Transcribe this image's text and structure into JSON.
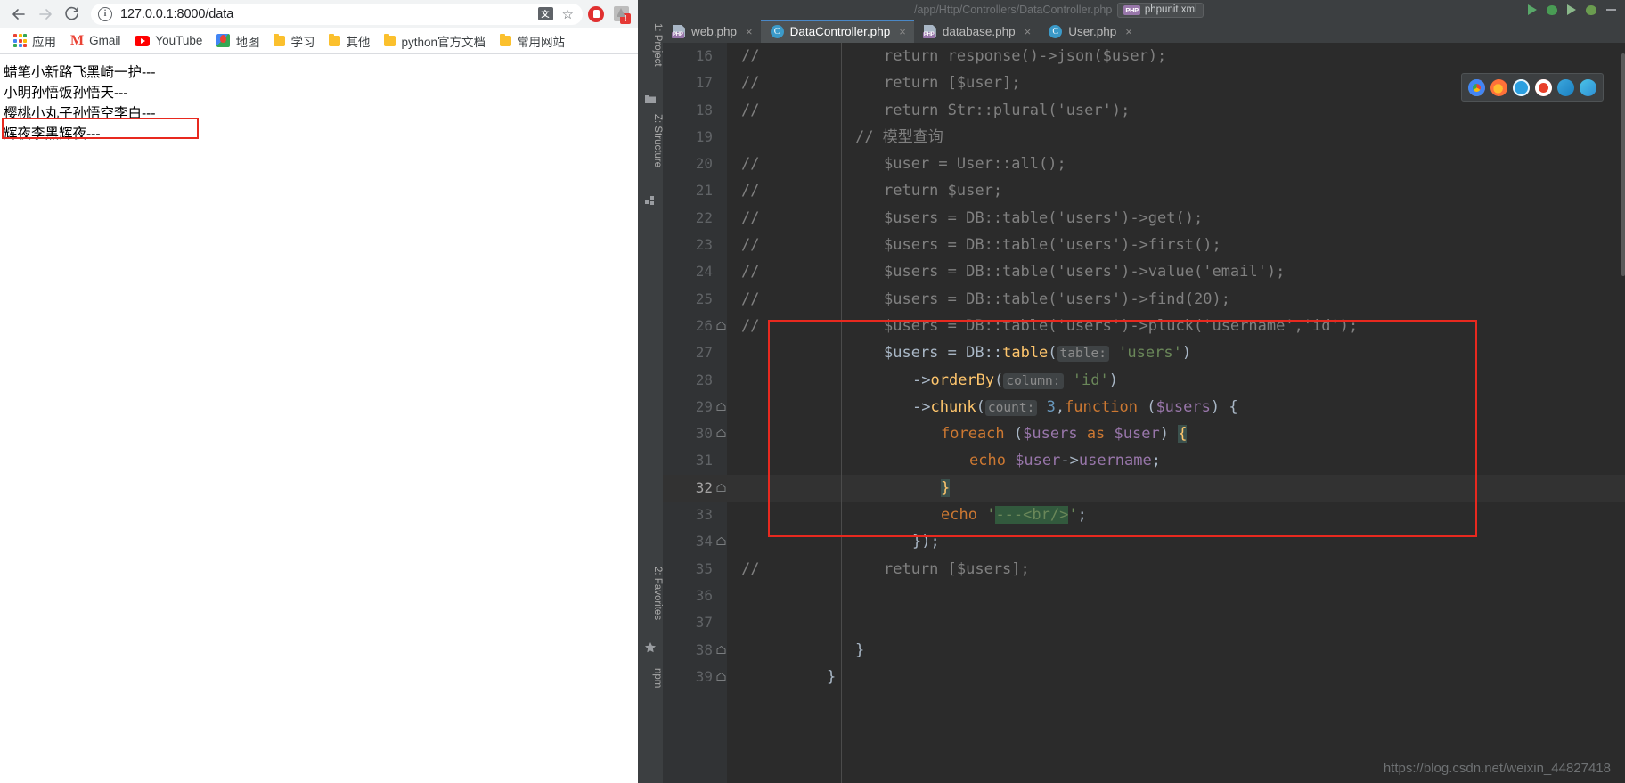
{
  "browser": {
    "nav": {
      "back": "←",
      "forward": "→",
      "reload": "⟳"
    },
    "omnibox": {
      "url": "127.0.0.1:8000/data",
      "info_icon": "info-icon",
      "translate_icon": "translate-icon",
      "star_icon": "bookmark-star-icon"
    },
    "extensions": [
      {
        "name": "adblock-extension-icon"
      },
      {
        "name": "unknown-extension-icon",
        "badge": "!"
      }
    ],
    "bookmarks": [
      {
        "label": "应用",
        "icon": "apps-grid-icon"
      },
      {
        "label": "Gmail",
        "icon": "gmail-icon"
      },
      {
        "label": "YouTube",
        "icon": "youtube-icon"
      },
      {
        "label": "地图",
        "icon": "maps-icon"
      },
      {
        "label": "学习",
        "icon": "folder-icon"
      },
      {
        "label": "其他",
        "icon": "folder-icon"
      },
      {
        "label": "python官方文档",
        "icon": "folder-icon"
      },
      {
        "label": "常用网站",
        "icon": "folder-icon"
      }
    ],
    "page_lines": [
      "蜡笔小新路飞黑崎一护---",
      "小明孙悟饭孙悟天---",
      "樱桃小丸子孙悟空李白---",
      "辉夜李黑辉夜---"
    ],
    "highlight_color": "#e8291f"
  },
  "ide": {
    "breadcrumb": "/app/Http/Controllers/DataController.php",
    "chip_label": "phpunit.xml",
    "chip_badge": "PHP",
    "tabs": [
      {
        "label": "web.php",
        "icon": "php-file-icon",
        "active": false,
        "close": "×"
      },
      {
        "label": "DataController.php",
        "icon": "php-class-icon",
        "active": true,
        "close": "×"
      },
      {
        "label": "database.php",
        "icon": "php-file-icon",
        "active": false,
        "close": "×"
      },
      {
        "label": "User.php",
        "icon": "php-class-icon",
        "active": false,
        "close": "×"
      }
    ],
    "rail": [
      {
        "label": "1: Project",
        "icon": "project-icon"
      },
      {
        "label": "Z: Structure",
        "icon": "structure-icon"
      },
      {
        "label": "2: Favorites",
        "icon": "favorites-star-icon"
      },
      {
        "label": "npm",
        "icon": "npm-icon"
      }
    ],
    "floating_toolbar": [
      "browser-chrome-icon",
      "browser-firefox-icon",
      "browser-safari-icon",
      "browser-opera-icon",
      "browser-edge-legacy-icon",
      "browser-edge-icon"
    ],
    "watermark": "https://blog.csdn.net/weixin_44827418",
    "cursor_line": 32,
    "highlight_color": "#e8291f",
    "code": [
      {
        "num": "16",
        "comment": "//",
        "indent": 3,
        "tokens": [
          {
            "t": "return ",
            "c": "c-com"
          },
          {
            "t": "response()->json($user);",
            "c": "c-com"
          }
        ]
      },
      {
        "num": "17",
        "comment": "//",
        "indent": 3,
        "tokens": [
          {
            "t": "return [$user];",
            "c": "c-com"
          }
        ]
      },
      {
        "num": "18",
        "comment": "//",
        "indent": 3,
        "tokens": [
          {
            "t": "return Str::plural('user');",
            "c": "c-com"
          }
        ]
      },
      {
        "num": "19",
        "comment": "",
        "indent": 2,
        "tokens": [
          {
            "t": "// 模型查询",
            "c": "c-com"
          }
        ]
      },
      {
        "num": "20",
        "comment": "//",
        "indent": 3,
        "tokens": [
          {
            "t": "$user = User::all();",
            "c": "c-com"
          }
        ]
      },
      {
        "num": "21",
        "comment": "//",
        "indent": 3,
        "tokens": [
          {
            "t": "return $user;",
            "c": "c-com"
          }
        ]
      },
      {
        "num": "22",
        "comment": "//",
        "indent": 3,
        "tokens": [
          {
            "t": "$users = DB::table('users')->get();",
            "c": "c-com"
          }
        ]
      },
      {
        "num": "23",
        "comment": "//",
        "indent": 3,
        "tokens": [
          {
            "t": "$users = DB::table('users')->first();",
            "c": "c-com"
          }
        ]
      },
      {
        "num": "24",
        "comment": "//",
        "indent": 3,
        "tokens": [
          {
            "t": "$users = DB::table('users')->value('email');",
            "c": "c-com"
          }
        ]
      },
      {
        "num": "25",
        "comment": "//",
        "indent": 3,
        "tokens": [
          {
            "t": "$users = DB::table('users')->find(20);",
            "c": "c-com"
          }
        ]
      },
      {
        "num": "26",
        "comment": "//",
        "indent": 3,
        "fold": true,
        "tokens": [
          {
            "t": "$users = DB::table('users')->pluck('username','id');",
            "c": "c-com"
          }
        ]
      },
      {
        "num": "27",
        "comment": "",
        "indent": 3,
        "tokens": [
          {
            "t": "$users ",
            "c": "c-def"
          },
          {
            "t": "= ",
            "c": "c-def"
          },
          {
            "t": "DB",
            "c": "c-cls"
          },
          {
            "t": "::",
            "c": "c-def"
          },
          {
            "t": "table",
            "c": "c-fn"
          },
          {
            "t": "(",
            "c": "c-def"
          },
          {
            "t": "table:",
            "c": "hint"
          },
          {
            "t": " ",
            "c": "c-def"
          },
          {
            "t": "'users'",
            "c": "c-str"
          },
          {
            "t": ")",
            "c": "c-def"
          }
        ]
      },
      {
        "num": "28",
        "comment": "",
        "indent": 4,
        "tokens": [
          {
            "t": "->",
            "c": "c-def"
          },
          {
            "t": "orderBy",
            "c": "c-fn"
          },
          {
            "t": "(",
            "c": "c-def"
          },
          {
            "t": "column:",
            "c": "hint"
          },
          {
            "t": " ",
            "c": "c-def"
          },
          {
            "t": "'id'",
            "c": "c-str"
          },
          {
            "t": ")",
            "c": "c-def"
          }
        ]
      },
      {
        "num": "29",
        "comment": "",
        "indent": 4,
        "fold": true,
        "tokens": [
          {
            "t": "->",
            "c": "c-def"
          },
          {
            "t": "chunk",
            "c": "c-fn"
          },
          {
            "t": "(",
            "c": "c-def"
          },
          {
            "t": "count:",
            "c": "hint"
          },
          {
            "t": " ",
            "c": "c-def"
          },
          {
            "t": "3",
            "c": "c-num"
          },
          {
            "t": ",",
            "c": "c-def"
          },
          {
            "t": "function ",
            "c": "c-kw"
          },
          {
            "t": "(",
            "c": "c-def"
          },
          {
            "t": "$users",
            "c": "c-var"
          },
          {
            "t": ") {",
            "c": "c-def"
          }
        ]
      },
      {
        "num": "30",
        "comment": "",
        "indent": 5,
        "fold": true,
        "tokens": [
          {
            "t": "foreach ",
            "c": "c-kw"
          },
          {
            "t": "(",
            "c": "c-def"
          },
          {
            "t": "$users",
            "c": "c-var"
          },
          {
            "t": " ",
            "c": "c-def"
          },
          {
            "t": "as",
            "c": "c-kw"
          },
          {
            "t": " ",
            "c": "c-def"
          },
          {
            "t": "$user",
            "c": "c-var"
          },
          {
            "t": ") ",
            "c": "c-def"
          },
          {
            "t": "{",
            "c": "brace-hl"
          }
        ]
      },
      {
        "num": "31",
        "comment": "",
        "indent": 6,
        "tokens": [
          {
            "t": "echo ",
            "c": "c-kw"
          },
          {
            "t": "$user",
            "c": "c-var"
          },
          {
            "t": "->",
            "c": "c-def"
          },
          {
            "t": "username",
            "c": "c-var"
          },
          {
            "t": ";",
            "c": "c-def"
          }
        ]
      },
      {
        "num": "32",
        "comment": "",
        "indent": 5,
        "fold": true,
        "cursor": true,
        "tokens": [
          {
            "t": "}",
            "c": "brace-hl"
          }
        ]
      },
      {
        "num": "33",
        "comment": "",
        "indent": 5,
        "tokens": [
          {
            "t": "echo ",
            "c": "c-kw"
          },
          {
            "t": "'",
            "c": "c-str"
          },
          {
            "t": "---<br/>",
            "c": "c-str str-hl"
          },
          {
            "t": "'",
            "c": "c-str"
          },
          {
            "t": ";",
            "c": "c-def"
          }
        ]
      },
      {
        "num": "34",
        "comment": "",
        "indent": 4,
        "fold": true,
        "tokens": [
          {
            "t": "});",
            "c": "c-def"
          }
        ]
      },
      {
        "num": "35",
        "comment": "//",
        "indent": 3,
        "tokens": [
          {
            "t": "return [$users];",
            "c": "c-com"
          }
        ]
      },
      {
        "num": "36",
        "comment": "",
        "indent": 0,
        "tokens": []
      },
      {
        "num": "37",
        "comment": "",
        "indent": 0,
        "tokens": []
      },
      {
        "num": "38",
        "comment": "",
        "indent": 2,
        "fold": true,
        "tokens": [
          {
            "t": "}",
            "c": "c-def"
          }
        ]
      },
      {
        "num": "39",
        "comment": "",
        "indent": 1,
        "fold": true,
        "tokens": [
          {
            "t": "}",
            "c": "c-def"
          }
        ]
      }
    ]
  }
}
